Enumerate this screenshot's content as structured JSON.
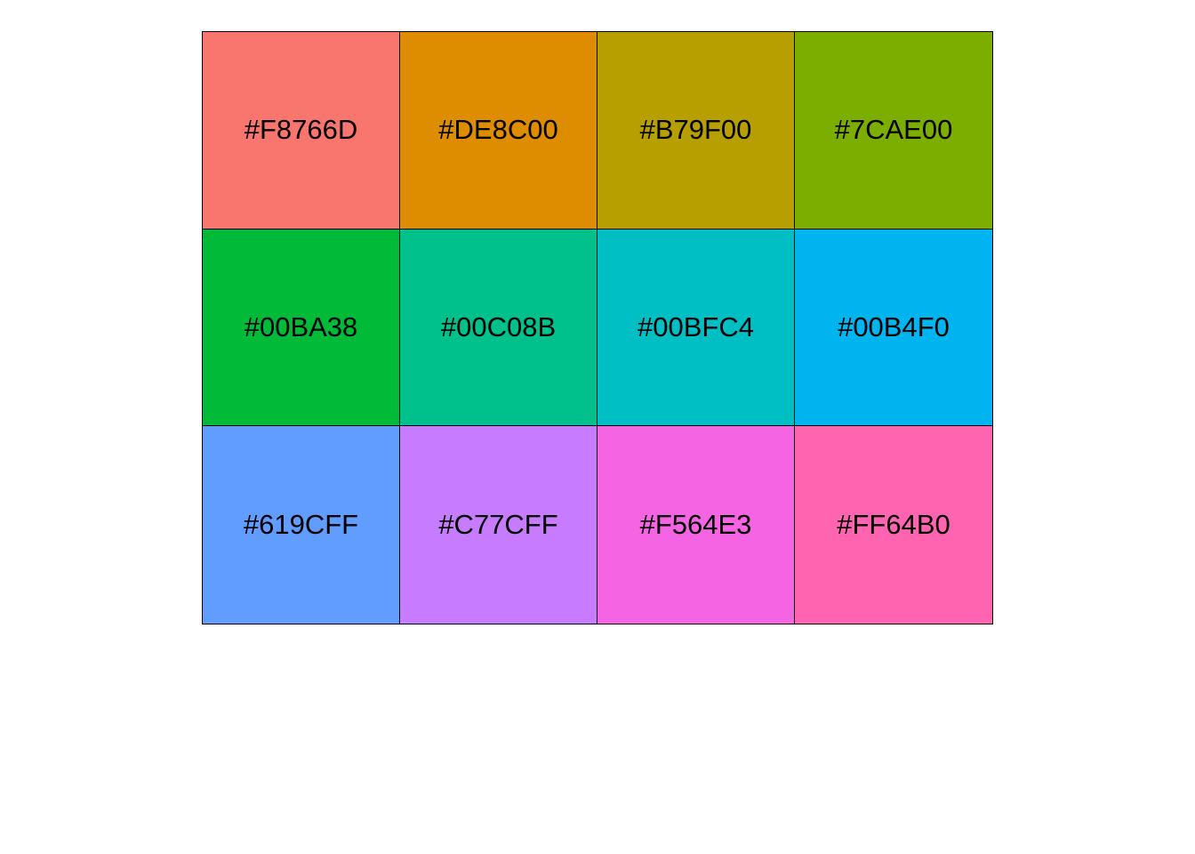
{
  "palette": {
    "swatches": [
      {
        "label": "#F8766D",
        "color": "#F8766D"
      },
      {
        "label": "#DE8C00",
        "color": "#DE8C00"
      },
      {
        "label": "#B79F00",
        "color": "#B79F00"
      },
      {
        "label": "#7CAE00",
        "color": "#7CAE00"
      },
      {
        "label": "#00BA38",
        "color": "#00BA38"
      },
      {
        "label": "#00C08B",
        "color": "#00C08B"
      },
      {
        "label": "#00BFC4",
        "color": "#00BFC4"
      },
      {
        "label": "#00B4F0",
        "color": "#00B4F0"
      },
      {
        "label": "#619CFF",
        "color": "#619CFF"
      },
      {
        "label": "#C77CFF",
        "color": "#C77CFF"
      },
      {
        "label": "#F564E3",
        "color": "#F564E3"
      },
      {
        "label": "#FF64B0",
        "color": "#FF64B0"
      }
    ]
  }
}
